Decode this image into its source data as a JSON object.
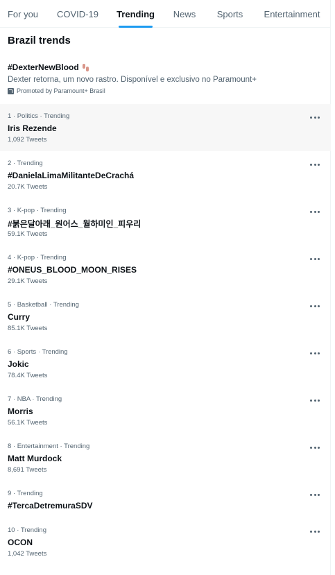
{
  "tabs": [
    {
      "label": "For you",
      "active": false
    },
    {
      "label": "COVID-19",
      "active": false
    },
    {
      "label": "Trending",
      "active": true
    },
    {
      "label": "News",
      "active": false
    },
    {
      "label": "Sports",
      "active": false
    },
    {
      "label": "Entertainment",
      "active": false
    }
  ],
  "section_title": "Brazil trends",
  "promoted": {
    "tag": "#DexterNewBlood",
    "emoji": "footprints-emoji",
    "description": "Dexter retorna, um novo rastro. Disponível e exclusivo no Paramount+",
    "promoted_by": "Promoted by Paramount+ Brasil",
    "promoted_icon": "promoted-arrow-icon"
  },
  "trends": [
    {
      "meta": "1 · Politics · Trending",
      "name": "Iris Rezende",
      "count": "1,092 Tweets"
    },
    {
      "meta": "2 · Trending",
      "name": "#DanielaLimaMilitanteDeCrachá",
      "count": "20.7K Tweets"
    },
    {
      "meta": "3 · K-pop · Trending",
      "name": "#붉은달아래_원어스_월하미인_피우리",
      "count": "59.1K Tweets"
    },
    {
      "meta": "4 · K-pop · Trending",
      "name": "#ONEUS_BLOOD_MOON_RISES",
      "count": "29.1K Tweets"
    },
    {
      "meta": "5 · Basketball · Trending",
      "name": "Curry",
      "count": "85.1K Tweets"
    },
    {
      "meta": "6 · Sports · Trending",
      "name": "Jokic",
      "count": "78.4K Tweets"
    },
    {
      "meta": "7 · NBA · Trending",
      "name": "Morris",
      "count": "56.1K Tweets"
    },
    {
      "meta": "8 · Entertainment · Trending",
      "name": "Matt Murdock",
      "count": "8,691 Tweets"
    },
    {
      "meta": "9 · Trending",
      "name": "#TercaDetremuraSDV",
      "count": ""
    },
    {
      "meta": "10 · Trending",
      "name": "OCON",
      "count": "1,042 Tweets"
    }
  ],
  "more_icon": "more-horizontal-icon",
  "colors": {
    "accent": "#1d9bf0",
    "text": "#0f1419",
    "secondary": "#536471",
    "hover": "#f7f7f7"
  }
}
